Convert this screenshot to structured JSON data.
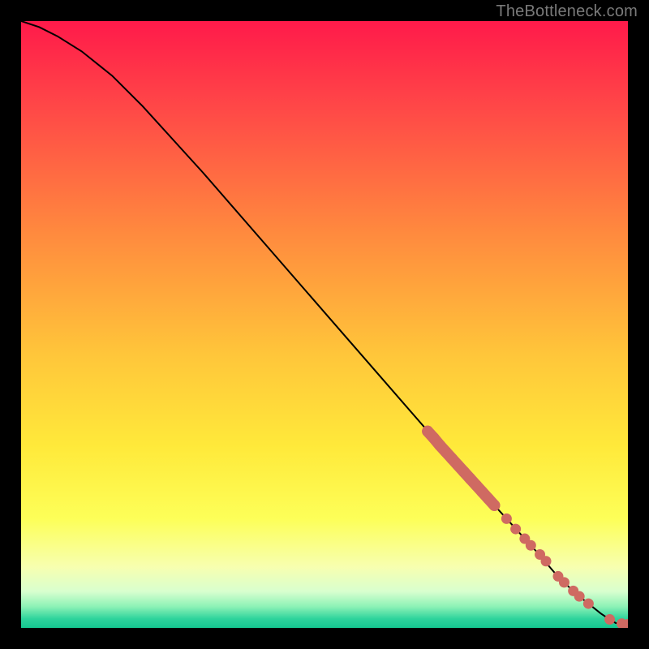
{
  "attribution": "TheBottleneck.com",
  "chart_data": {
    "type": "line",
    "title": "",
    "xlabel": "",
    "ylabel": "",
    "xlim": [
      0,
      100
    ],
    "ylim": [
      0,
      100
    ],
    "grid": false,
    "legend": false,
    "background": "vertical-heat-gradient",
    "series": [
      {
        "name": "curve",
        "style": "line",
        "color": "#000000",
        "x": [
          0,
          3,
          6,
          10,
          15,
          20,
          30,
          40,
          50,
          60,
          70,
          75,
          80,
          85,
          88,
          90,
          92,
          94,
          95.5,
          97,
          98,
          100
        ],
        "y": [
          100,
          99,
          97.5,
          95,
          91,
          86,
          75,
          63.5,
          52,
          40.5,
          29,
          23.5,
          18,
          12.5,
          9,
          7,
          5.2,
          3.6,
          2.4,
          1.4,
          0.8,
          0.6
        ]
      },
      {
        "name": "highlight-segment-upper",
        "style": "thick-marker-run",
        "color": "#cf6a62",
        "x": [
          67,
          68,
          69,
          70,
          71,
          72,
          73,
          74,
          75,
          76,
          77,
          78
        ],
        "y": [
          32.4,
          31.3,
          30.1,
          29.0,
          27.9,
          26.8,
          25.7,
          24.6,
          23.5,
          22.4,
          21.3,
          20.2
        ]
      },
      {
        "name": "highlight-segment-mid",
        "style": "markers",
        "color": "#cf6a62",
        "x": [
          80,
          81.5,
          83,
          84,
          85.5,
          86.5
        ],
        "y": [
          18.0,
          16.3,
          14.7,
          13.6,
          12.1,
          11.0
        ]
      },
      {
        "name": "highlight-segment-lower",
        "style": "markers",
        "color": "#cf6a62",
        "x": [
          88.5,
          89.5,
          91,
          92,
          93.5
        ],
        "y": [
          8.5,
          7.5,
          6.1,
          5.2,
          4.0
        ]
      },
      {
        "name": "tail-markers",
        "style": "markers",
        "color": "#cf6a62",
        "x": [
          97,
          99,
          100
        ],
        "y": [
          1.4,
          0.7,
          0.6
        ]
      }
    ],
    "gradient_stops": [
      {
        "pos": 0.0,
        "color": "#ff1a4a"
      },
      {
        "pos": 0.15,
        "color": "#ff4a47"
      },
      {
        "pos": 0.35,
        "color": "#ff8a3e"
      },
      {
        "pos": 0.55,
        "color": "#ffc63a"
      },
      {
        "pos": 0.7,
        "color": "#ffe93a"
      },
      {
        "pos": 0.82,
        "color": "#fdff58"
      },
      {
        "pos": 0.9,
        "color": "#f7ffb0"
      },
      {
        "pos": 0.94,
        "color": "#d8ffcf"
      },
      {
        "pos": 0.965,
        "color": "#8cf2b6"
      },
      {
        "pos": 0.985,
        "color": "#2ed39c"
      },
      {
        "pos": 1.0,
        "color": "#15c890"
      }
    ]
  }
}
